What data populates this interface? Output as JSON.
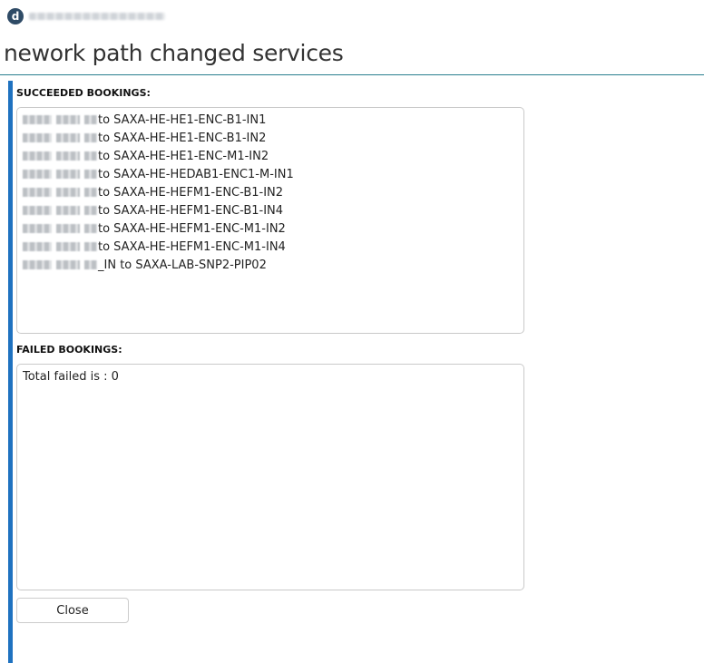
{
  "header": {
    "logo_letter": "d"
  },
  "page": {
    "title": "nework path changed services"
  },
  "succeeded": {
    "label": "SUCCEEDED BOOKINGS:",
    "items": [
      "to SAXA-HE-HE1-ENC-B1-IN1",
      "to SAXA-HE-HE1-ENC-B1-IN2",
      "to SAXA-HE-HE1-ENC-M1-IN2",
      "to SAXA-HE-HEDAB1-ENC1-M-IN1",
      "to SAXA-HE-HEFM1-ENC-B1-IN2",
      "to SAXA-HE-HEFM1-ENC-B1-IN4",
      "to SAXA-HE-HEFM1-ENC-M1-IN2",
      "to SAXA-HE-HEFM1-ENC-M1-IN4",
      "_IN to SAXA-LAB-SNP2-PIP02"
    ]
  },
  "failed": {
    "label": "FAILED BOOKINGS:",
    "items": [
      "Total failed is : 0"
    ]
  },
  "actions": {
    "close_label": "Close"
  },
  "colors": {
    "accent_bar": "#1f72c0",
    "title_rule": "#2a7f8f",
    "logo_bg": "#2f4b66"
  },
  "icons": {
    "logo": "d-logo-icon"
  }
}
